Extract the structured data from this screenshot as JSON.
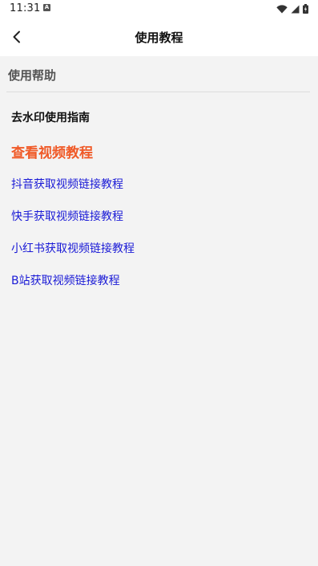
{
  "status_bar": {
    "time": "11:31",
    "notification_icon": "a-box-icon",
    "wifi_icon": "wifi-icon",
    "signal_icon": "signal-icon",
    "battery_icon": "battery-icon"
  },
  "header": {
    "back_icon": "chevron-left-icon",
    "title": "使用教程"
  },
  "content": {
    "section_title": "使用帮助",
    "guide_heading": "去水印使用指南",
    "video_heading": "查看视频教程",
    "links": [
      "抖音获取视频链接教程",
      "快手获取视频链接教程",
      "小红书获取视频链接教程",
      "B站获取视频链接教程"
    ]
  },
  "colors": {
    "video_heading": "#f05a28",
    "link": "#1a1ad6",
    "background": "#f3f3f3"
  }
}
